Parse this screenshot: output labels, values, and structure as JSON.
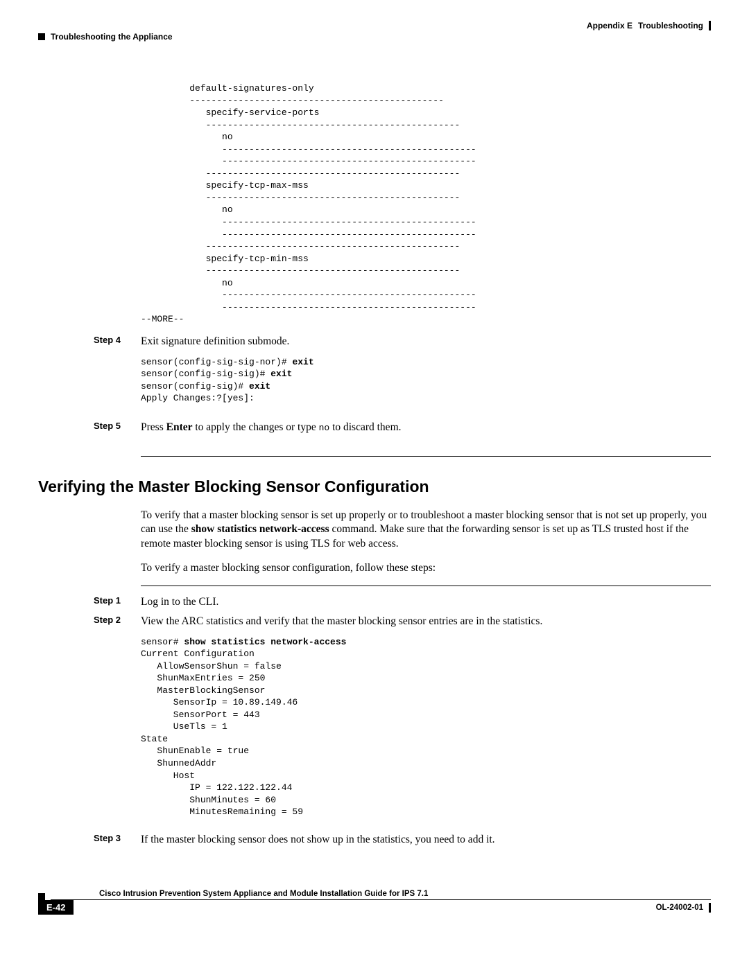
{
  "header": {
    "appendix": "Appendix E",
    "chapter": "Troubleshooting",
    "section": "Troubleshooting the Appliance"
  },
  "code_block_1": "         default-signatures-only\n         -----------------------------------------------\n            specify-service-ports\n            -----------------------------------------------\n               no\n               -----------------------------------------------\n               -----------------------------------------------\n            -----------------------------------------------\n            specify-tcp-max-mss\n            -----------------------------------------------\n               no\n               -----------------------------------------------\n               -----------------------------------------------\n            -----------------------------------------------\n            specify-tcp-min-mss\n            -----------------------------------------------\n               no\n               -----------------------------------------------\n               -----------------------------------------------\n--MORE--",
  "steps_a": {
    "step4": {
      "label": "Step 4",
      "text": "Exit signature definition submode.",
      "code_prefix1": "sensor(config-sig-sig-nor)# ",
      "code_bold1": "exit",
      "code_prefix2": "sensor(config-sig-sig)# ",
      "code_bold2": "exit",
      "code_prefix3": "sensor(config-sig)# ",
      "code_bold3": "exit",
      "code_line4": "Apply Changes:?[yes]:"
    },
    "step5": {
      "label": "Step 5",
      "pre": "Press ",
      "enter": "Enter",
      "mid": " to apply the changes or type ",
      "no": "no",
      "post": " to discard them."
    }
  },
  "section_heading": "Verifying the Master Blocking Sensor Configuration",
  "para1_a": "To verify that a master blocking sensor is set up properly or to troubleshoot a master blocking sensor that is not set up properly, you can use the ",
  "para1_bold": "show statistics network-access",
  "para1_b": " command. Make sure that the forwarding sensor is set up as TLS trusted host if the remote master blocking sensor is using TLS for web access.",
  "para2": "To verify a master blocking sensor configuration, follow these steps:",
  "steps_b": {
    "step1": {
      "label": "Step 1",
      "text": "Log in to the CLI."
    },
    "step2": {
      "label": "Step 2",
      "text": "View the ARC statistics and verify that the master blocking sensor entries are in the statistics.",
      "code_prefix": "sensor# ",
      "code_bold": "show statistics network-access",
      "code_rest": "Current Configuration\n   AllowSensorShun = false\n   ShunMaxEntries = 250\n   MasterBlockingSensor\n      SensorIp = 10.89.149.46\n      SensorPort = 443\n      UseTls = 1\nState\n   ShunEnable = true\n   ShunnedAddr\n      Host\n         IP = 122.122.122.44\n         ShunMinutes = 60\n         MinutesRemaining = 59"
    },
    "step3": {
      "label": "Step 3",
      "text": "If the master blocking sensor does not show up in the statistics, you need to add it."
    }
  },
  "footer": {
    "title": "Cisco Intrusion Prevention System Appliance and Module Installation Guide for IPS 7.1",
    "page": "E-42",
    "docid": "OL-24002-01"
  }
}
